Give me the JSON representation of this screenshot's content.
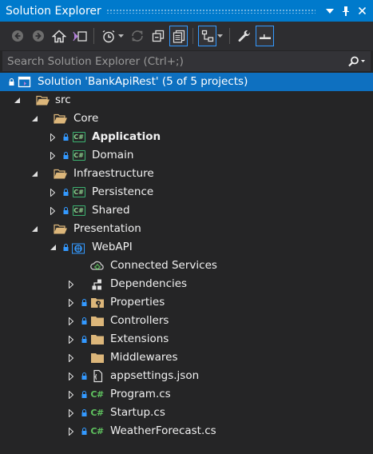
{
  "window": {
    "title": "Solution Explorer",
    "dropdown_icon": "dropdown-arrow-icon",
    "pin_icon": "pin-icon",
    "close_icon": "close-icon"
  },
  "toolbar": {
    "buttons": [
      "back-icon",
      "forward-icon",
      "home-icon",
      "switch-views-icon",
      "pending-changes-filter-icon",
      "sync-icon",
      "collapse-all-icon",
      "show-all-files-icon",
      "preview-selected-icon",
      "properties-icon",
      "preview-icon"
    ]
  },
  "search": {
    "placeholder": "Search Solution Explorer (Ctrl+;)",
    "value": ""
  },
  "tree": {
    "solution": "Solution 'BankApiRest' (5 of 5 projects)",
    "src": "src",
    "core": "Core",
    "application": "Application",
    "domain": "Domain",
    "infra": "Infraestructure",
    "persistence": "Persistence",
    "shared": "Shared",
    "presentation": "Presentation",
    "webapi": "WebAPI",
    "connected_services": "Connected Services",
    "dependencies": "Dependencies",
    "properties": "Properties",
    "controllers": "Controllers",
    "extensions": "Extensions",
    "middlewares": "Middlewares",
    "appsettings": "appsettings.json",
    "program": "Program.cs",
    "startup": "Startup.cs",
    "weatherforecast": "WeatherForecast.cs"
  },
  "icon_labels": {
    "csproj": "C#",
    "csfile": "C#"
  },
  "colors": {
    "accent": "#007acc",
    "selection": "#0e70c0",
    "background": "#252526",
    "folder": "#dcb67a",
    "csharp": "#3cb371",
    "lock": "#3399ff"
  }
}
